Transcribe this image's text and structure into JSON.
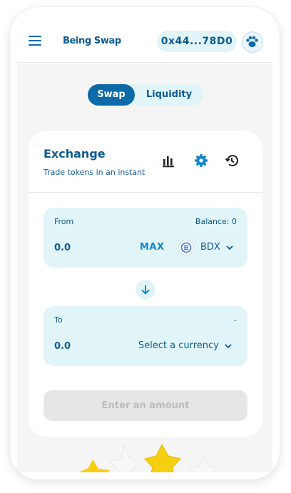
{
  "header": {
    "app_title": "Being Swap",
    "wallet_address": "0x44...78D0"
  },
  "tabs": [
    {
      "label": "Swap",
      "active": true
    },
    {
      "label": "Liquidity",
      "active": false
    }
  ],
  "card": {
    "title": "Exchange",
    "subtitle": "Trade tokens in an instant"
  },
  "from": {
    "label": "From",
    "balance": "Balance: 0",
    "amount": "0.0",
    "max_label": "MAX",
    "token": "BDX"
  },
  "to": {
    "label": "To",
    "balance": "-",
    "amount": "0.0",
    "currency_placeholder": "Select a currency"
  },
  "submit_label": "Enter an amount",
  "colors": {
    "primary": "#0d6aa8",
    "text": "#0d5a92",
    "panel": "#e1f5f8",
    "star_yellow": "#f5cf10",
    "disabled": "#e6e6e6"
  },
  "icons": [
    "hamburger-icon",
    "avatar-paw-icon",
    "chart-icon",
    "settings-icon",
    "history-icon",
    "token-bdx-icon",
    "chevron-down-icon",
    "arrow-down-icon",
    "star-icon"
  ]
}
